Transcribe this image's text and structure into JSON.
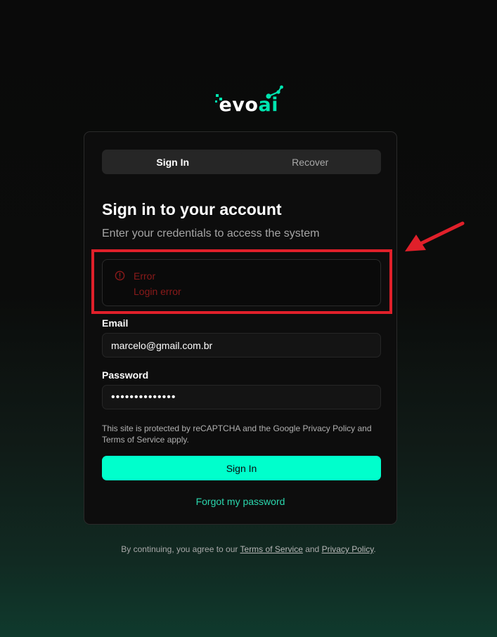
{
  "brand": {
    "logo_text_main": "evo",
    "logo_text_accent": "ai",
    "accent_color": "#00e6b0"
  },
  "tabs": [
    {
      "label": "Sign In",
      "active": true
    },
    {
      "label": "Recover",
      "active": false
    }
  ],
  "form": {
    "title": "Sign in to your account",
    "subtitle": "Enter your credentials to access the system",
    "error": {
      "icon": "alert-circle-icon",
      "title": "Error",
      "message": "Login error",
      "color": "#8a1a1a"
    },
    "email_label": "Email",
    "email_value": "marcelo@gmail.com.br",
    "password_label": "Password",
    "password_value": "••••••••••••••",
    "recaptcha_notice": "This site is protected by reCAPTCHA and the Google Privacy Policy and Terms of Service apply.",
    "submit_label": "Sign In",
    "submit_color": "#00ffcc",
    "forgot_label": "Forgot my password"
  },
  "footer": {
    "prefix": "By continuing, you agree to our ",
    "terms_label": "Terms of Service",
    "and": " and ",
    "privacy_label": "Privacy Policy",
    "suffix": "."
  },
  "annotation": {
    "color": "#e0202a"
  }
}
